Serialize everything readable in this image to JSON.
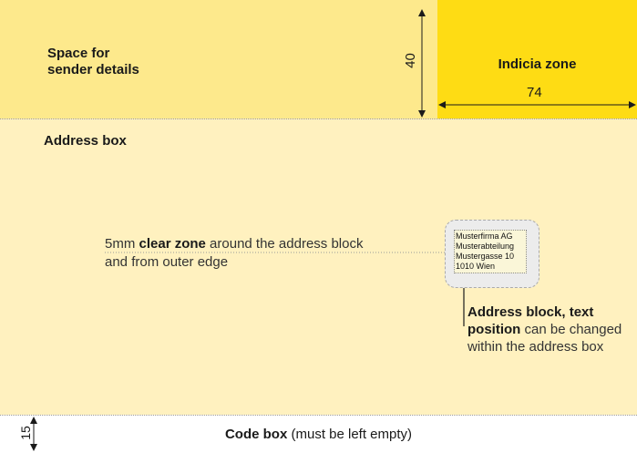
{
  "sender": {
    "line1": "Space for",
    "line2": "sender details"
  },
  "indicia": {
    "title": "Indicia zone",
    "width_label": "74"
  },
  "height_label_top": "40",
  "address_box": {
    "title": "Address box"
  },
  "clear_zone": {
    "prefix": "5mm ",
    "bold": "clear zone",
    "rest": " around the address block",
    "line2": "and from outer edge"
  },
  "address_block": {
    "lines": [
      "Musterfirma AG",
      "Musterabteilung",
      "Mustergasse 10",
      "1010 Wien"
    ]
  },
  "explanation": {
    "bold": "Address block, text position",
    "rest": " can be changed within the address box"
  },
  "code_box": {
    "bold": "Code box",
    "rest": " (must be left empty)"
  },
  "height_label_bottom": "15",
  "colors": {
    "sender": "#fde98c",
    "indicia": "#fedc14",
    "address": "#fff1bf"
  }
}
